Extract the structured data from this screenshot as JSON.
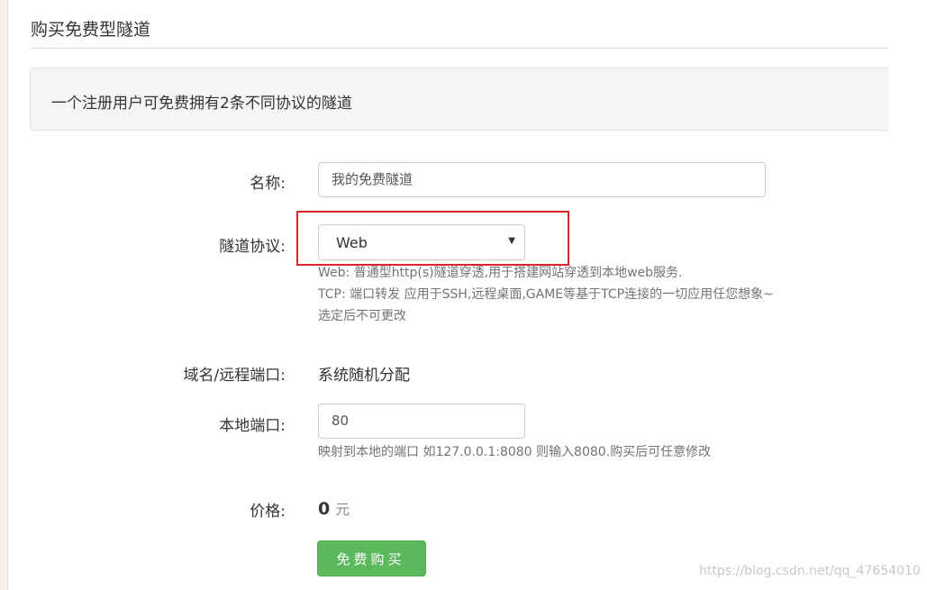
{
  "page": {
    "title": "购买免费型隧道",
    "notice": "一个注册用户可免费拥有2条不同协议的隧道"
  },
  "form": {
    "name": {
      "label": "名称:",
      "value": "我的免费隧道"
    },
    "protocol": {
      "label": "隧道协议:",
      "selected": "Web",
      "help_lines": [
        "Web: 普通型http(s)隧道穿透,用于搭建网站穿透到本地web服务.",
        "TCP: 端口转发 应用于SSH,远程桌面,GAME等基于TCP连接的一切应用任您想象~",
        "选定后不可更改"
      ]
    },
    "domain_port": {
      "label": "域名/远程端口:",
      "value": "系统随机分配"
    },
    "local_port": {
      "label": "本地端口:",
      "value": "80",
      "help": "映射到本地的端口 如127.0.0.1:8080 则输入8080.购买后可任意修改"
    },
    "price": {
      "label": "价格:",
      "amount": "0",
      "unit": "元"
    },
    "submit_label": "免费购买"
  },
  "colors": {
    "highlight_box": "#e0242d",
    "button": "#5cb85c"
  },
  "watermark": "https://blog.csdn.net/qq_47654010"
}
